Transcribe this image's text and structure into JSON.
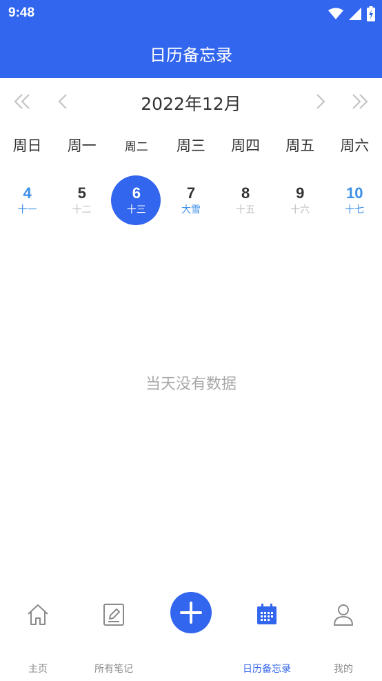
{
  "status_bar": {
    "time": "9:48"
  },
  "header": {
    "title": "日历备忘录"
  },
  "month_nav": {
    "month_title": "2022年12月"
  },
  "weekdays": [
    "周日",
    "周一",
    "周二",
    "周三",
    "周四",
    "周五",
    "周六"
  ],
  "days": [
    {
      "num": "4",
      "lunar": "十一"
    },
    {
      "num": "5",
      "lunar": "十二"
    },
    {
      "num": "6",
      "lunar": "十三"
    },
    {
      "num": "7",
      "lunar": "大雪"
    },
    {
      "num": "8",
      "lunar": "十五"
    },
    {
      "num": "9",
      "lunar": "十六"
    },
    {
      "num": "10",
      "lunar": "十七"
    }
  ],
  "selected_day_index": 2,
  "empty_text": "当天没有数据",
  "tabs": [
    {
      "label": "主页",
      "icon": "home-icon"
    },
    {
      "label": "所有笔记",
      "icon": "edit-note-icon"
    },
    {
      "label": "日历备忘录",
      "icon": "calendar-icon"
    },
    {
      "label": "我的",
      "icon": "user-icon"
    }
  ],
  "colors": {
    "primary": "#3366ee",
    "weekend": "#3b8fe8",
    "muted": "#c0c0c0"
  }
}
